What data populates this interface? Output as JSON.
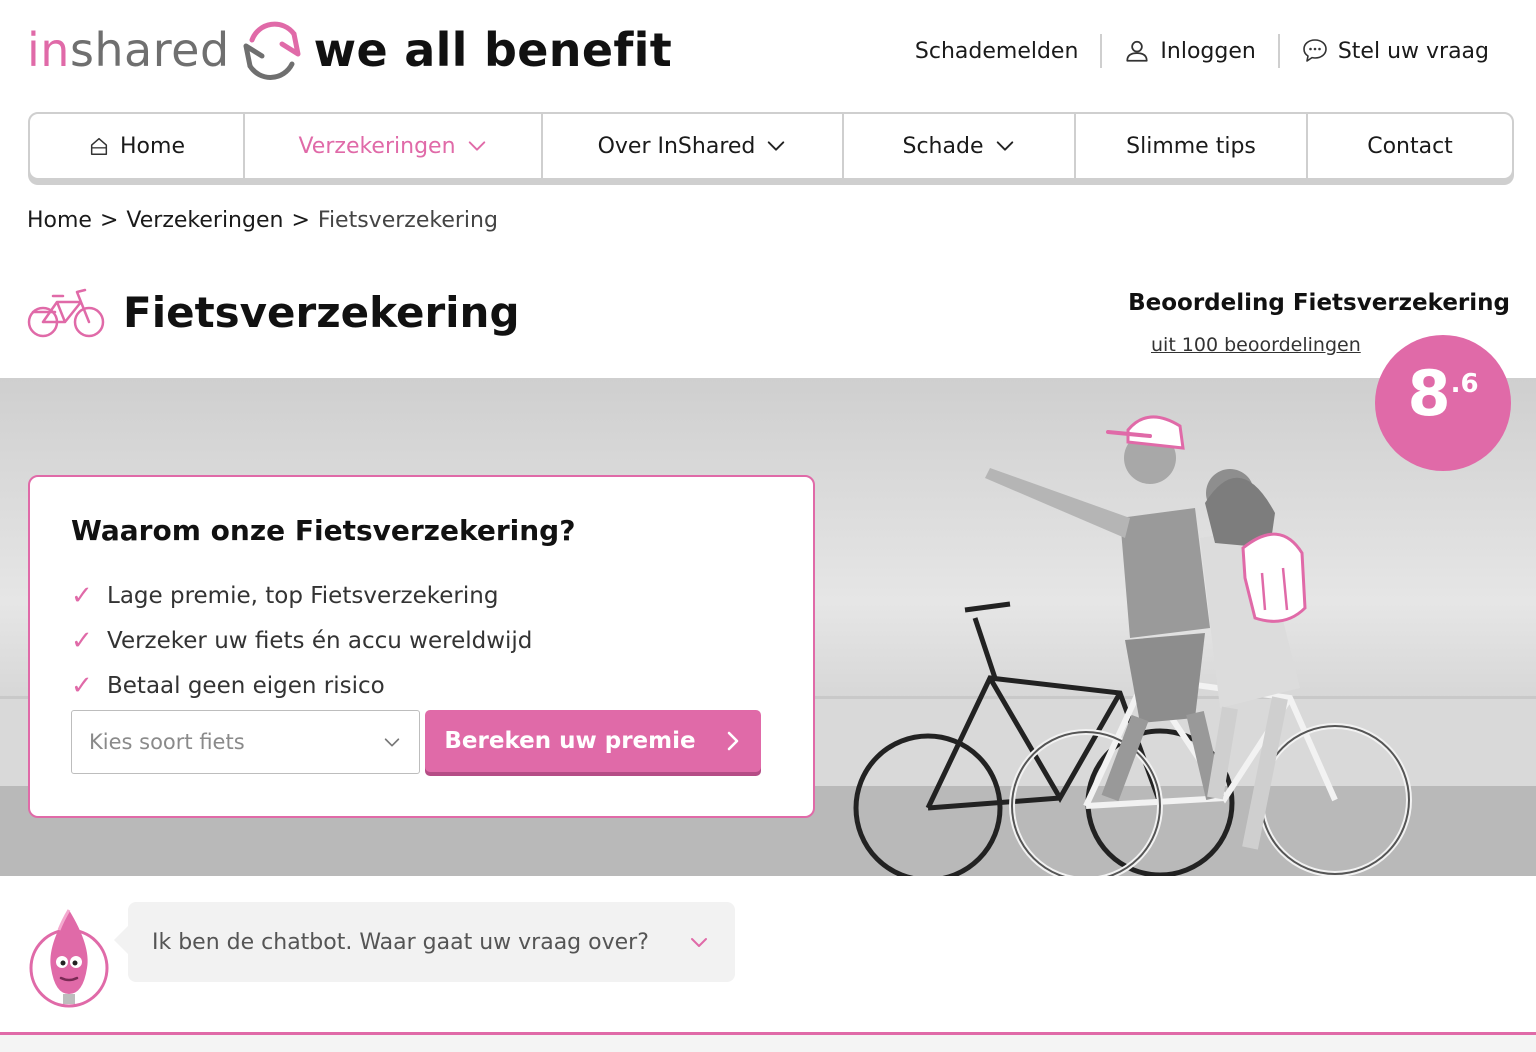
{
  "logo": {
    "in": "in",
    "shared": "shared",
    "tagline": "we all benefit"
  },
  "top_links": {
    "damage": "Schademelden",
    "login": "Inloggen",
    "ask": "Stel uw vraag"
  },
  "nav": {
    "items": [
      {
        "label": "Home",
        "icon": "home-icon"
      },
      {
        "label": "Verzekeringen",
        "icon": "chevron-down-icon",
        "active": true
      },
      {
        "label": "Over InShared",
        "icon": "chevron-down-icon"
      },
      {
        "label": "Schade",
        "icon": "chevron-down-icon"
      },
      {
        "label": "Slimme tips"
      },
      {
        "label": "Contact"
      }
    ]
  },
  "breadcrumb": {
    "home": "Home",
    "sep": ">",
    "insurances": "Verzekeringen",
    "current": "Fietsverzekering"
  },
  "page": {
    "title": "Fietsverzekering",
    "icon": "bicycle-icon"
  },
  "rating": {
    "title": "Beoordeling Fietsverzekering",
    "subtitle": "uit 100 beoordelingen",
    "score_main": "8",
    "score_decimal": ".6"
  },
  "card": {
    "title": "Waarom onze Fietsverzekering?",
    "usps": [
      "Lage premie, top Fietsverzekering",
      "Verzeker uw fiets én accu wereldwijd",
      "Betaal geen eigen risico"
    ],
    "select_placeholder": "Kies soort fiets",
    "cta": "Bereken uw premie"
  },
  "chatbot": {
    "text": "Ik ben de chatbot. Waar gaat uw vraag over?"
  },
  "colors": {
    "accent": "#e06aa8",
    "border": "#cfcfcf",
    "text": "#1a1a1a"
  }
}
